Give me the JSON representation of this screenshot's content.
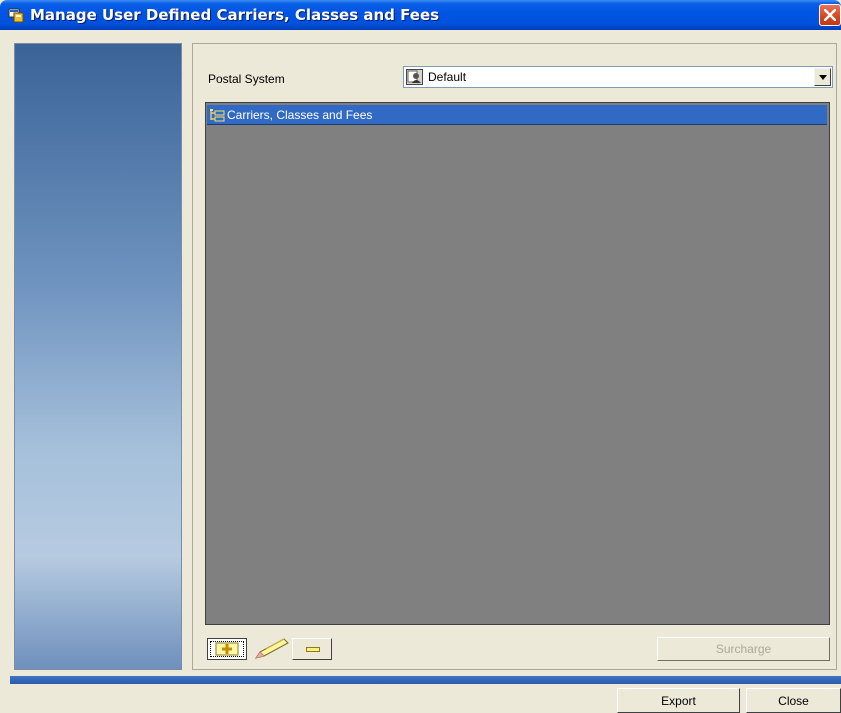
{
  "window": {
    "title": "Manage User Defined Carriers, Classes and Fees",
    "title_color": "#0054e3"
  },
  "postal_system": {
    "label": "Postal System",
    "selected": "Default",
    "icon": "postal-system-icon"
  },
  "tree": {
    "items": [
      {
        "label": "Carriers, Classes and Fees",
        "icon": "tree-folder-icon",
        "selected": true
      }
    ],
    "background": "#808080",
    "selection_color": "#316ac5"
  },
  "toolbar": {
    "add_icon": "add-icon",
    "edit_icon": "pencil-icon",
    "remove_icon": "remove-icon",
    "surcharge_label": "Surcharge"
  },
  "footer": {
    "export_label": "Export",
    "close_label": "Close"
  }
}
